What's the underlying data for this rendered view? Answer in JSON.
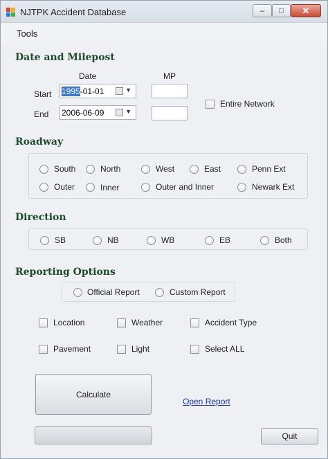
{
  "window": {
    "title": "NJTPK Accident Database",
    "icon": "app-grid-icon",
    "minimize_glyph": "–",
    "maximize_glyph": "□",
    "close_glyph": "✕"
  },
  "menu": {
    "tools": "Tools"
  },
  "date_section": {
    "title": "Date and Milepost",
    "date_header": "Date",
    "mp_header": "MP",
    "start_label": "Start",
    "end_label": "End",
    "start_date_selected": "1995",
    "start_date_rest": "-01-01",
    "end_date": "2006-06-09",
    "start_mp": "",
    "end_mp": "",
    "entire_network": "Entire Network"
  },
  "roadway": {
    "title": "Roadway",
    "options": [
      "South",
      "North",
      "West",
      "East",
      "Penn Ext",
      "Outer",
      "Inner",
      "Outer and Inner",
      "Newark Ext"
    ]
  },
  "direction": {
    "title": "Direction",
    "options": [
      "SB",
      "NB",
      "WB",
      "EB",
      "Both"
    ]
  },
  "reporting": {
    "title": "Reporting Options",
    "report_types": [
      "Official Report",
      "Custom Report"
    ],
    "fields": [
      "Location",
      "Weather",
      "Accident Type",
      "Pavement",
      "Light",
      "Select ALL"
    ]
  },
  "actions": {
    "calculate": "Calculate",
    "open_report": "Open Report",
    "quit": "Quit",
    "progress": 0
  },
  "colors": {
    "section_title": "#1b4a2c",
    "link": "#1a32b8",
    "selection": "#3a78d4"
  }
}
